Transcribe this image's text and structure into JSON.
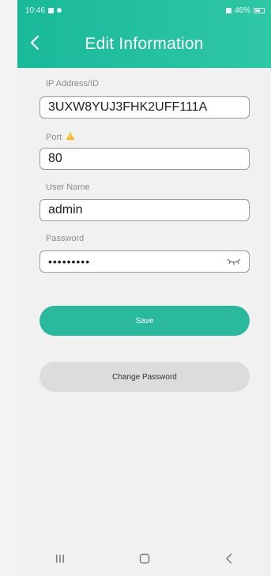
{
  "status": {
    "time": "10:46",
    "battery": "46%"
  },
  "header": {
    "title": "Edit Information"
  },
  "form": {
    "ip": {
      "label": "IP Address/ID",
      "value": "3UXW8YUJ3FHK2UFF111A"
    },
    "port": {
      "label": "Port",
      "value": "80"
    },
    "user": {
      "label": "User Name",
      "value": "admin"
    },
    "password": {
      "label": "Password",
      "value": "•••••••••"
    }
  },
  "buttons": {
    "save": "Save",
    "change_password": "Change Password"
  },
  "colors": {
    "accent": "#2bb99e",
    "header": "#19b99a",
    "warning": "#f5b400"
  },
  "icons": {
    "back": "chevron-left-icon",
    "show_password": "eye-closed-icon",
    "warning": "warning-icon"
  }
}
